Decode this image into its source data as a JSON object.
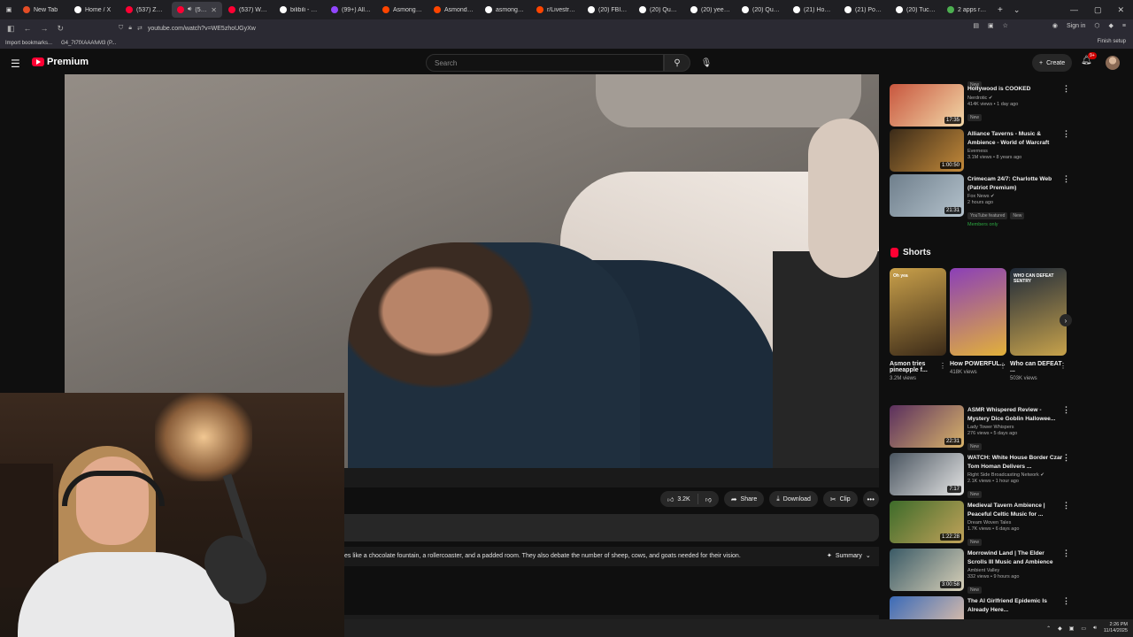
{
  "browser": {
    "tabs": [
      {
        "title": "New Tab",
        "color": "#e44d26",
        "active": false
      },
      {
        "title": "Home / X",
        "color": "#ffffff",
        "active": false
      },
      {
        "title": "(537) ZackRa",
        "color": "#ff0033",
        "active": false
      },
      {
        "title": "(537) A",
        "color": "#ff0033",
        "active": true
      },
      {
        "title": "(537) Watch le",
        "color": "#ff0033",
        "active": false
      },
      {
        "title": "bilibili - Goo",
        "color": "#ffffff",
        "active": false
      },
      {
        "title": "(99+) All Cate",
        "color": "#9146ff",
        "active": false
      },
      {
        "title": "Asmongold",
        "color": "#ff4500",
        "active": false
      },
      {
        "title": "Asmond's hou",
        "color": "#ff4500",
        "active": false
      },
      {
        "title": "asmongold re",
        "color": "#ffffff",
        "active": false
      },
      {
        "title": "r/Livestreamfa",
        "color": "#ff4500",
        "active": false
      },
      {
        "title": "(20) FBI Direct",
        "color": "#ffffff",
        "active": false
      },
      {
        "title": "(20) Quotes o",
        "color": "#ffffff",
        "active": false
      },
      {
        "title": "(20) yeet on X",
        "color": "#ffffff",
        "active": false
      },
      {
        "title": "(20) Quotes o",
        "color": "#ffffff",
        "active": false
      },
      {
        "title": "(21) Home / X",
        "color": "#ffffff",
        "active": false
      },
      {
        "title": "(21) Posts like",
        "color": "#ffffff",
        "active": false
      },
      {
        "title": "(20) Tucker Ca",
        "color": "#ffffff",
        "active": false
      },
      {
        "title": "2 apps remov",
        "color": "#4caf50",
        "active": false
      }
    ],
    "new_tab": "+",
    "tab_list": "⌄",
    "url": "youtube.com/watch?v=WE5zhoUGyXw",
    "sign_in": "Sign in",
    "bookmarks": [
      "Import bookmarks...",
      "G4_7t7fXAAAfvM3 (P..."
    ],
    "finish_setup": "Finish setup"
  },
  "youtube": {
    "brand": "Premium",
    "search_placeholder": "Search",
    "create_label": "Create",
    "notif_count": "9+"
  },
  "video": {
    "likes": "3.2K",
    "share": "Share",
    "download": "Download",
    "clip": "Clip",
    "description": "es like a chocolate fountain, a rollercoaster, and a padded room. They also debate the number of sheep, cows, and goats needed for their vision.",
    "summary": "Summary"
  },
  "recommendations_top": [
    {
      "title": "Hollywood is COOKED",
      "channel": "Nerdrotic ✔",
      "views": "414K views • 1 day ago",
      "badges": [
        "New"
      ],
      "duration": "17:35",
      "thumb": "#c8563e",
      "thumb2": "#f2d8a8"
    },
    {
      "title": "Alliance Taverns - Music & Ambience - World of Warcraft",
      "channel": "Everness",
      "views": "3.1M views • 8 years ago",
      "badges": [],
      "duration": "1:00:50",
      "thumb": "#3a2a18",
      "thumb2": "#c48a3a"
    },
    {
      "title": "Crimecam 24/7: Charlotte Web (Patriot Premium)",
      "channel": "Fox News ✔",
      "views": "2 hours ago",
      "badges": [
        "YouTube featured",
        "New"
      ],
      "members": "Members only",
      "duration": "21:31",
      "thumb": "#6f7f8c",
      "thumb2": "#b4c2cc"
    }
  ],
  "shorts": {
    "heading": "Shorts",
    "items": [
      {
        "title": "Asmon tries pineapple f...",
        "views": "3.2M views",
        "overlay": "Oh yea",
        "bg1": "#c9a04a",
        "bg2": "#3b2a18"
      },
      {
        "title": "How POWERFUL...",
        "views": "418K views",
        "overlay": "",
        "bg1": "#8b3fb8",
        "bg2": "#e2b13a"
      },
      {
        "title": "Who can DEFEAT ...",
        "views": "503K views",
        "overlay": "WHO CAN DEFEAT SENTRY",
        "bg1": "#1f2a3a",
        "bg2": "#c7a24b"
      }
    ]
  },
  "recommendations_bottom": [
    {
      "title": "ASMR Whispered Review - Mystery Dice Goblin Hallowee...",
      "channel": "Lady Tower Whispers",
      "views": "276 views • 5 days ago",
      "badges": [
        "New"
      ],
      "duration": "22:31",
      "thumb": "#5a2f5e",
      "thumb2": "#d9b46a"
    },
    {
      "title": "WATCH: White House Border Czar Tom Homan Delivers ...",
      "channel": "Right Side Broadcasting Network ✔",
      "views": "2.1K views • 1 hour ago",
      "badges": [
        "New"
      ],
      "duration": "7:17",
      "thumb": "#4a5560",
      "thumb2": "#e4e4e4"
    },
    {
      "title": "Medieval Tavern Ambience | Peaceful Celtic Music for ...",
      "channel": "Dream Woven Tales",
      "views": "1.7K views • 6 days ago",
      "badges": [
        "New"
      ],
      "duration": "1:22:28",
      "thumb": "#3d6b2a",
      "thumb2": "#c2a35a"
    },
    {
      "title": "Morrowind Land | The Elder Scrolls III Music and Ambience",
      "channel": "Ambient Valley",
      "views": "332 views • 9 hours ago",
      "badges": [
        "New"
      ],
      "duration": "3:00:58",
      "thumb": "#3a5a66",
      "thumb2": "#d8d0b8"
    },
    {
      "title": "The AI Girlfriend Epidemic Is Already Here...",
      "channel": "",
      "views": "",
      "badges": [],
      "duration": "",
      "thumb": "#3a6ab8",
      "thumb2": "#f0c8a8"
    }
  ],
  "taskbar": {
    "time": "2:26 PM",
    "date": "11/14/2025"
  }
}
